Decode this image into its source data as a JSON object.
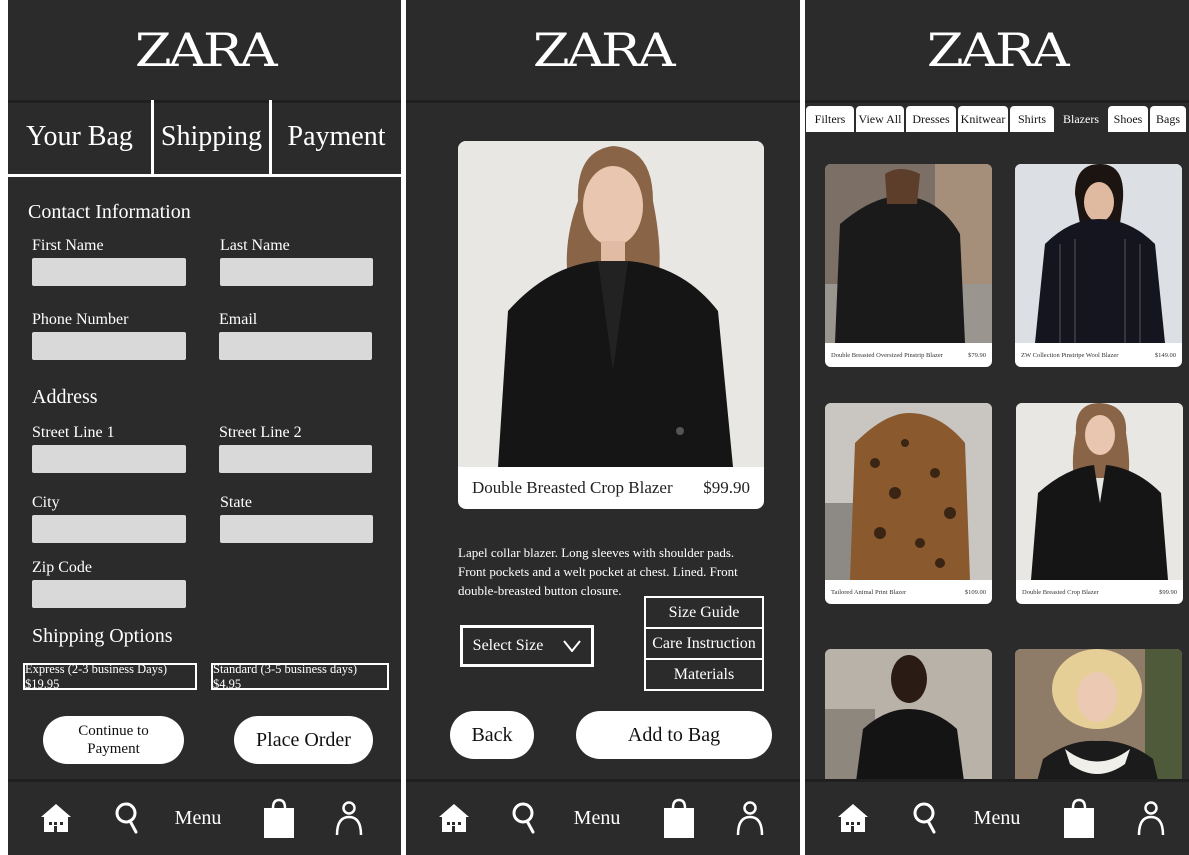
{
  "brand": {
    "logo": "ZARA"
  },
  "checkout": {
    "steps": [
      "Your Bag",
      "Shipping",
      "Payment"
    ],
    "contact_title": "Contact Information",
    "labels": {
      "first_name": "First Name",
      "last_name": "Last Name",
      "phone": "Phone Number",
      "email": "Email",
      "street1": "Street Line 1",
      "street2": "Street Line 2",
      "city": "City",
      "state": "State",
      "zip": "Zip Code"
    },
    "address_title": "Address",
    "shipping_title": "Shipping Options",
    "shipping_options": [
      "Express (2-3 business Days) $19.95",
      "Standard (3-5 business days) $4.95"
    ],
    "continue_label": "Continue to Payment",
    "place_order_label": "Place Order"
  },
  "product_detail": {
    "name": "Double Breasted Crop Blazer",
    "price": "$99.90",
    "description": "Lapel collar blazer. Long sleeves with shoulder pads. Front pockets and a welt pocket at chest. Lined. Front double-breasted button closure.",
    "select_size": "Select Size",
    "info_links": [
      "Size Guide",
      "Care Instruction",
      "Materials"
    ],
    "back_label": "Back",
    "add_label": "Add to Bag"
  },
  "catalog": {
    "tabs": [
      "Filters",
      "View All",
      "Dresses",
      "Knitwear",
      "Shirts",
      "Blazers",
      "Shoes",
      "Bags"
    ],
    "active_tab": "Blazers",
    "products": [
      {
        "name": "Double Breasted Oversized Pinstrip Blazer",
        "price": "$79.90"
      },
      {
        "name": "ZW Collection Pinstripe Wool Blazer",
        "price": "$149.00"
      },
      {
        "name": "Tailored Animal Print Blazer",
        "price": "$109.00"
      },
      {
        "name": "Double Breasted Crop Blazer",
        "price": "$99.90"
      },
      {
        "name": "",
        "price": ""
      },
      {
        "name": "",
        "price": ""
      }
    ]
  },
  "nav": {
    "menu_label": "Menu"
  },
  "icons": [
    "home-icon",
    "search-icon",
    "shopping-bag-icon",
    "user-icon",
    "chevron-down-icon"
  ],
  "colors": {
    "background": "#2b2b2b",
    "field": "#d9d9d9",
    "text": "#ffffff"
  }
}
